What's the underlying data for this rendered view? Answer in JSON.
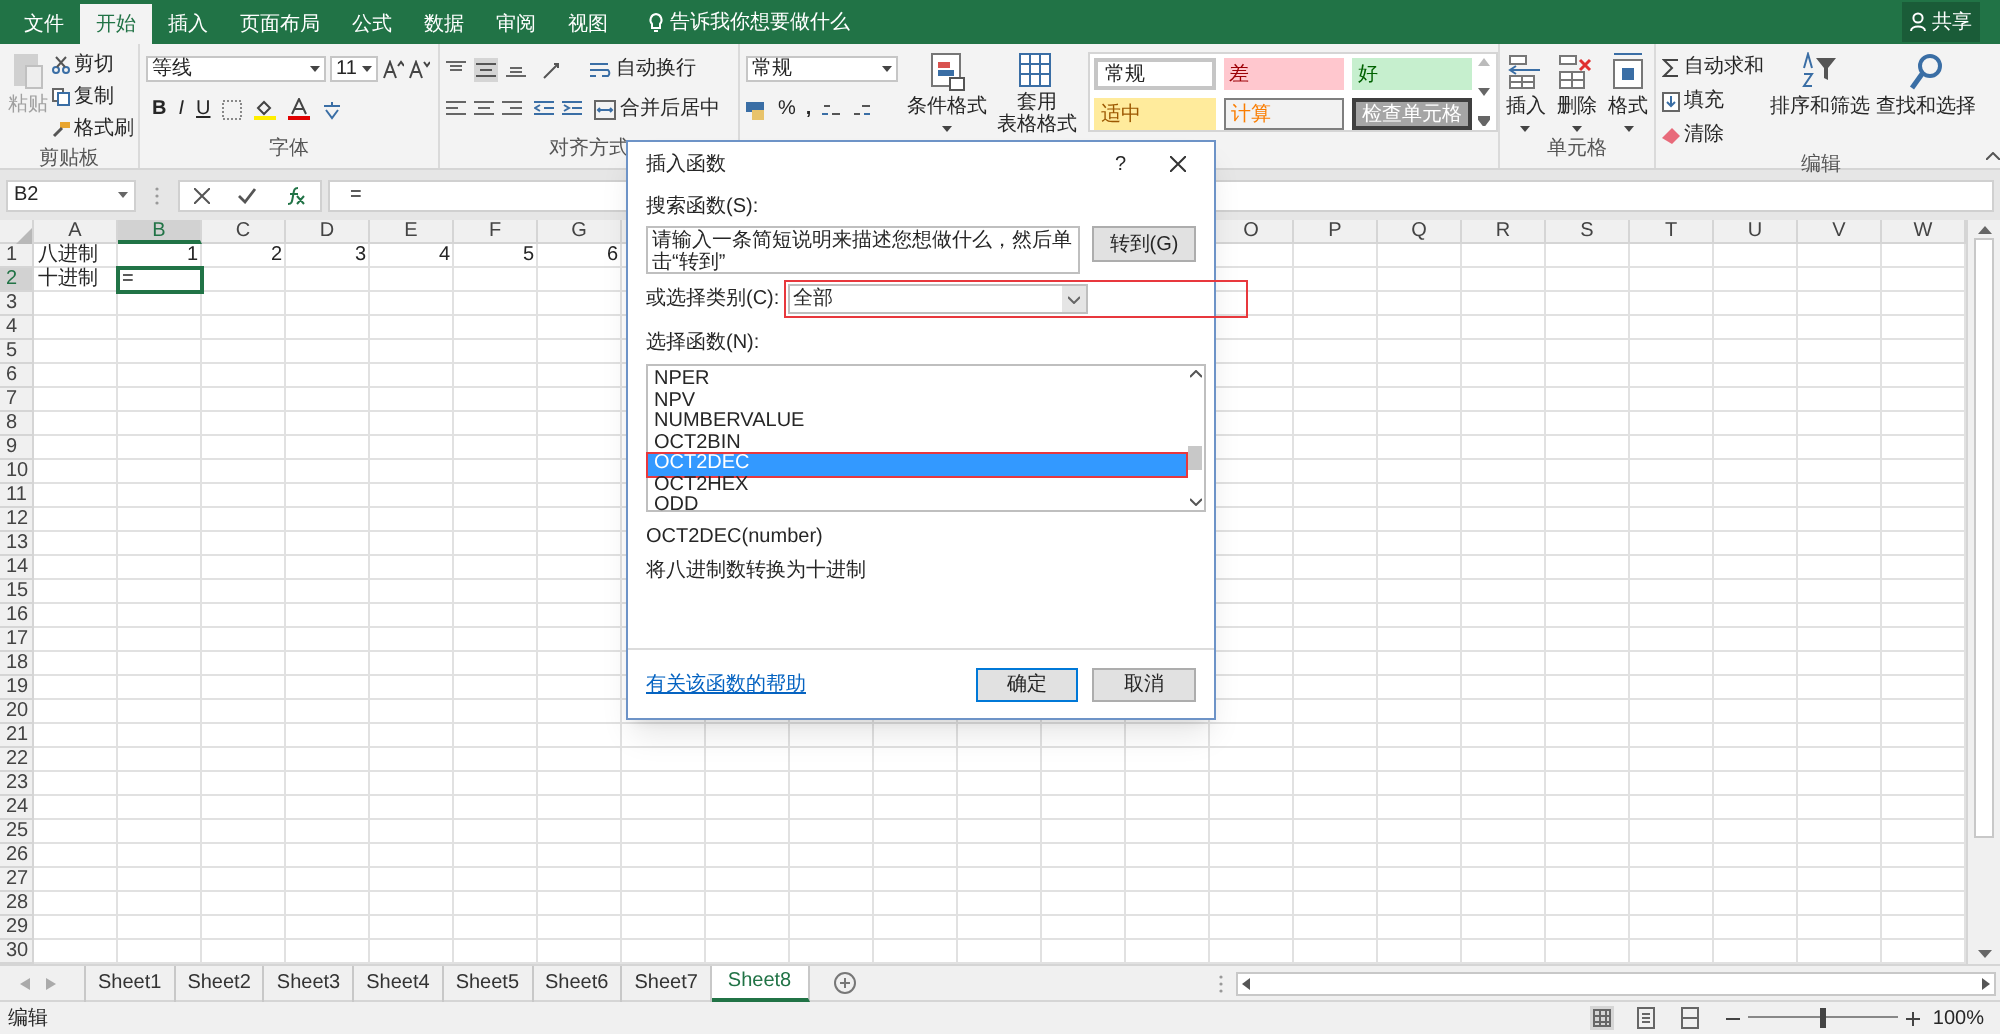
{
  "tabs": [
    {
      "label": "文件",
      "selected": false
    },
    {
      "label": "开始",
      "selected": true
    },
    {
      "label": "插入",
      "selected": false
    },
    {
      "label": "页面布局",
      "selected": false
    },
    {
      "label": "公式",
      "selected": false
    },
    {
      "label": "数据",
      "selected": false
    },
    {
      "label": "审阅",
      "selected": false
    },
    {
      "label": "视图",
      "selected": false
    }
  ],
  "tell_me": "告诉我你想要做什么",
  "share": "共享",
  "ribbon": {
    "clipboard": {
      "paste": "粘贴",
      "paste_disabled": true,
      "cut": "剪切",
      "copy": "复制",
      "format_painter": "格式刷",
      "label": "剪贴板"
    },
    "font": {
      "font_name": "等线",
      "font_size": "11",
      "bold": "B",
      "italic": "I",
      "underline": "U",
      "label": "字体"
    },
    "alignment": {
      "wrap": "自动换行",
      "merge": "合并后居中",
      "label": "对齐方式"
    },
    "number": {
      "format": "常规",
      "percent": "%",
      "comma": ","
    },
    "styles": {
      "conditional": "条件格式",
      "table_1": "套用",
      "table_2": "表格格式",
      "gallery": [
        {
          "label": "常规",
          "kind": "normal"
        },
        {
          "label": "差",
          "kind": "bad"
        },
        {
          "label": "好",
          "kind": "good"
        },
        {
          "label": "适中",
          "kind": "neutral"
        },
        {
          "label": "计算",
          "kind": "calculation"
        },
        {
          "label": "检查单元格",
          "kind": "check"
        }
      ]
    },
    "cells": {
      "insert": "插入",
      "delete": "删除",
      "format": "格式",
      "label": "单元格"
    },
    "editing": {
      "autosum": "自动求和",
      "fill": "填充",
      "clear": "清除",
      "sort": "排序和筛选",
      "find": "查找和选择",
      "label": "编辑"
    }
  },
  "formula_bar": {
    "name_box": "B2",
    "formula": "="
  },
  "sheet": {
    "columns_left": [
      "A",
      "B",
      "C",
      "D",
      "E",
      "F",
      "G"
    ],
    "columns_right": [
      "O",
      "P",
      "Q",
      "R",
      "S",
      "T",
      "U",
      "V",
      "W"
    ],
    "rows": [
      {
        "number": "1",
        "cells": [
          {
            "text": "八进制",
            "kind": "text",
            "selected": false
          },
          {
            "text": "1",
            "kind": "number",
            "selected": false
          },
          {
            "text": "2",
            "kind": "number",
            "selected": false
          },
          {
            "text": "3",
            "kind": "number",
            "selected": false
          },
          {
            "text": "4",
            "kind": "number",
            "selected": false
          },
          {
            "text": "5",
            "kind": "number",
            "selected": false
          },
          {
            "text": "6",
            "kind": "number",
            "selected": false
          }
        ]
      },
      {
        "number": "2",
        "cells": [
          {
            "text": "十进制",
            "kind": "text",
            "selected": false
          },
          {
            "text": "=",
            "kind": "text",
            "selected": true
          }
        ]
      },
      {
        "number": "3"
      },
      {
        "number": "4"
      },
      {
        "number": "5"
      },
      {
        "number": "6"
      },
      {
        "number": "7"
      },
      {
        "number": "8"
      },
      {
        "number": "9"
      },
      {
        "number": "10"
      },
      {
        "number": "11"
      },
      {
        "number": "12"
      },
      {
        "number": "13"
      },
      {
        "number": "14"
      },
      {
        "number": "15"
      },
      {
        "number": "16"
      },
      {
        "number": "17"
      },
      {
        "number": "18"
      },
      {
        "number": "19"
      },
      {
        "number": "20"
      },
      {
        "number": "21"
      },
      {
        "number": "22"
      },
      {
        "number": "23"
      },
      {
        "number": "24"
      },
      {
        "number": "25"
      },
      {
        "number": "26"
      },
      {
        "number": "27"
      },
      {
        "number": "28"
      },
      {
        "number": "29"
      },
      {
        "number": "30"
      }
    ]
  },
  "sheet_tabs": [
    {
      "label": "Sheet1",
      "selected": false
    },
    {
      "label": "Sheet2",
      "selected": false
    },
    {
      "label": "Sheet3",
      "selected": false
    },
    {
      "label": "Sheet4",
      "selected": false
    },
    {
      "label": "Sheet5",
      "selected": false
    },
    {
      "label": "Sheet6",
      "selected": false
    },
    {
      "label": "Sheet7",
      "selected": false
    },
    {
      "label": "Sheet8",
      "selected": true
    }
  ],
  "status_bar": {
    "mode": "编辑",
    "zoom": "100%",
    "zoom_slider": {
      "level": 0.5
    }
  },
  "dialog": {
    "title": "插入函数",
    "help": "?",
    "search_label": "搜索函数(S):",
    "search_text": "请输入一条简短说明来描述您想做什么，然后单击“转到”",
    "go": "转到(G)",
    "category_label": "或选择类别(C):",
    "category": "全部",
    "category_highlighted": true,
    "function_label": "选择函数(N):",
    "functions": [
      {
        "name": "NPER",
        "selected": false,
        "highlighted": false
      },
      {
        "name": "NPV",
        "selected": false,
        "highlighted": false
      },
      {
        "name": "NUMBERVALUE",
        "selected": false,
        "highlighted": false
      },
      {
        "name": "OCT2BIN",
        "selected": false,
        "highlighted": false
      },
      {
        "name": "OCT2DEC",
        "selected": true,
        "highlighted": true
      },
      {
        "name": "OCT2HEX",
        "selected": false,
        "highlighted": false
      },
      {
        "name": "ODD",
        "selected": false,
        "highlighted": false
      }
    ],
    "signature": "OCT2DEC(number)",
    "description": "将八进制数转换为十进制",
    "help_link": "有关该函数的帮助",
    "ok": "确定",
    "cancel": "取消"
  }
}
